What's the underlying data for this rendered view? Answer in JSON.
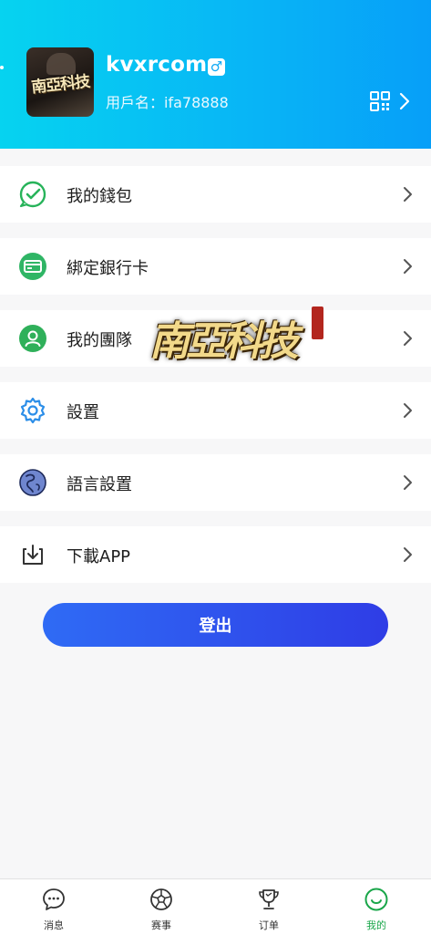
{
  "profile": {
    "username": "kvxrcom",
    "gender_symbol": "♂",
    "user_id_text": "用戶名：ifa78888",
    "avatar_text": "南亞科技"
  },
  "menu": [
    {
      "label": "我的錢包",
      "icon": "wallet-check-icon"
    },
    {
      "label": "綁定銀行卡",
      "icon": "bank-card-icon"
    },
    {
      "label": "我的團隊",
      "icon": "team-user-icon"
    },
    {
      "label": "設置",
      "icon": "gear-icon"
    },
    {
      "label": "語言設置",
      "icon": "language-globe-icon"
    },
    {
      "label": "下載APP",
      "icon": "download-icon"
    }
  ],
  "watermark_text": "南亞科技",
  "logout_label": "登出",
  "tabbar": [
    {
      "label": "消息",
      "icon": "message-icon"
    },
    {
      "label": "赛事",
      "icon": "soccer-ball-icon"
    },
    {
      "label": "订单",
      "icon": "trophy-icon"
    },
    {
      "label": "我的",
      "icon": "smile-icon",
      "active": true
    }
  ],
  "colors": {
    "header_start": "#06d3f0",
    "header_end": "#079ff8",
    "logout_start": "#2f6bf5",
    "logout_end": "#2f3de6",
    "active_tab": "#1aa64a"
  }
}
